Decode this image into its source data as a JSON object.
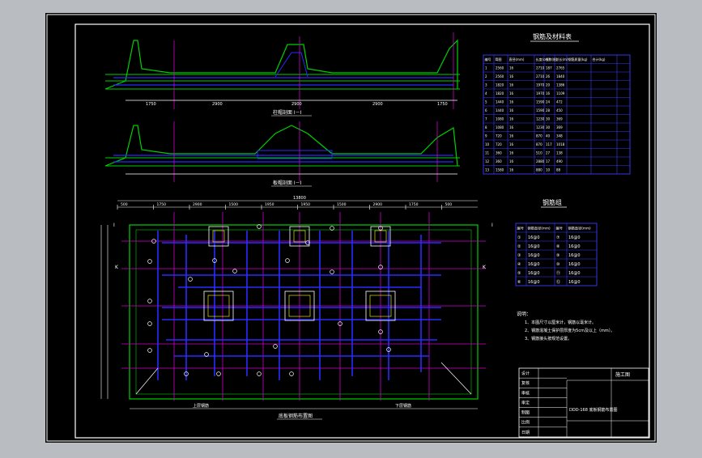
{
  "palette": {
    "background": "#b9bcc1",
    "sheet": "#000000",
    "frame": "#ffffff",
    "concrete": "#00d000",
    "rebar": "#2a2aff",
    "axis": "#d000d0",
    "text": "#ffffff",
    "table_line": "#3a3aff",
    "accent": "#ffff33"
  },
  "titles": {
    "section_top": "柱帽剖面 I－I",
    "section_bottom": "板帽剖面 I－I",
    "plan": "底板钢筋布置图",
    "rebar_table": "钢筋及材料表",
    "rebar_group": "钢筋组"
  },
  "plan_dimensions": {
    "overall": "13800",
    "segments": [
      "500",
      "1750",
      "2900",
      "1500",
      "1950",
      "1950",
      "1500",
      "2900",
      "1750",
      "500"
    ]
  },
  "section_dimensions": {
    "top": [
      "1750",
      "2900",
      "2900",
      "2900",
      "1750"
    ]
  },
  "axis_labels": {
    "left": "I",
    "right": "I",
    "side_left": "K",
    "side_right": "K"
  },
  "bottom_notes": {
    "left": "上层钢筋",
    "right": "下层钢筋"
  },
  "rebar_table": {
    "headers": [
      "编号",
      "简图",
      "直径(mm)",
      "长度(cm)",
      "根数(根)",
      "总长(m)",
      "钢筋质量(kg)",
      "合计(kg)"
    ],
    "rows": [
      [
        "1",
        "2560",
        "16",
        "2710",
        "187",
        "2765",
        "",
        ""
      ],
      [
        "2",
        "2560",
        "16",
        "2710",
        "26",
        "1840",
        "",
        ""
      ],
      [
        "3",
        "1820",
        "16",
        "1970",
        "20",
        "1386",
        "",
        ""
      ],
      [
        "4",
        "1820",
        "16",
        "1970",
        "16",
        "1109",
        "",
        ""
      ],
      [
        "5",
        "1440",
        "16",
        "1590",
        "24",
        "472",
        "",
        ""
      ],
      [
        "6",
        "1440",
        "16",
        "1590",
        "28",
        "450",
        "",
        ""
      ],
      [
        "7",
        "1080",
        "16",
        "1230",
        "30",
        "369",
        "",
        ""
      ],
      [
        "8",
        "1080",
        "16",
        "1230",
        "30",
        "369",
        "",
        ""
      ],
      [
        "9",
        "720",
        "16",
        "870",
        "40",
        "348",
        "",
        ""
      ],
      [
        "10",
        "720",
        "16",
        "870",
        "117",
        "1018",
        "",
        ""
      ],
      [
        "11",
        "360",
        "16",
        "510",
        "27",
        "138",
        "",
        ""
      ],
      [
        "12",
        "360",
        "16",
        "2880",
        "17",
        "490",
        "",
        ""
      ],
      [
        "13",
        "1580",
        "16",
        "880",
        "10",
        "88",
        "",
        ""
      ]
    ]
  },
  "rebar_group_table": {
    "headers": [
      "编号",
      "钢筋直径(mm)",
      "编号",
      "钢筋直径(mm)"
    ],
    "rows": [
      [
        "①",
        "16@0",
        "⑦",
        "16@0"
      ],
      [
        "②",
        "16@0",
        "⑧",
        "16@0"
      ],
      [
        "③",
        "16@0",
        "⑨",
        "16@0"
      ],
      [
        "④",
        "16@0",
        "⑩",
        "16@0"
      ],
      [
        "⑤",
        "16@0",
        "⑪",
        "16@0"
      ],
      [
        "⑥",
        "16@0",
        "⑫",
        "16@0"
      ]
    ]
  },
  "notes": {
    "heading": "说明：",
    "items": [
      "1、本图尺寸以厘米计，钢筋以毫米计。",
      "2、钢筋混凝土保护层厚度为5cm及以上（mm）。",
      "3、钢筋接头按规范设置。"
    ]
  },
  "title_block": {
    "project": "DDD-168 底板钢筋布置图",
    "sheet_label": "施工图",
    "rows": [
      "设计",
      "复核",
      "审核",
      "审定",
      "制图",
      "比例",
      "日期"
    ]
  }
}
